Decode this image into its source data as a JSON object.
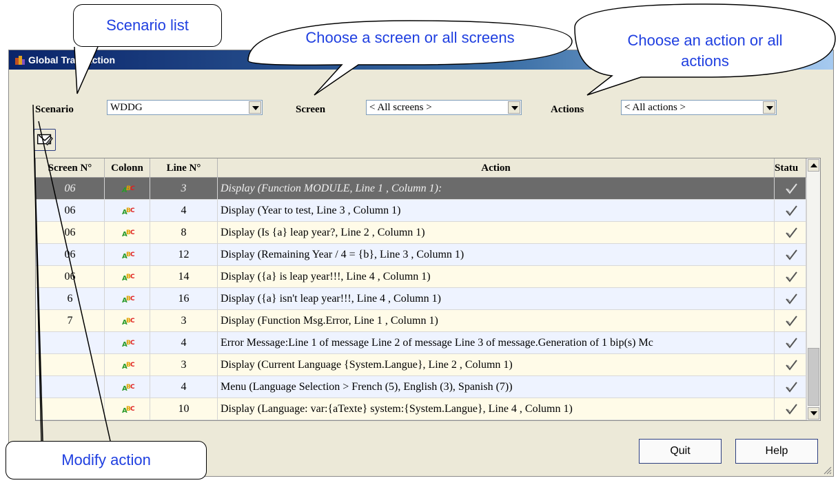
{
  "window": {
    "title": "Global Transaction"
  },
  "filters": {
    "scenario_label": "Scenario",
    "scenario_value": "WDDG",
    "screen_label": "Screen",
    "screen_value": "< All screens >",
    "actions_label": "Actions",
    "actions_value": "< All actions >"
  },
  "grid": {
    "columns": [
      "Screen N°",
      "Colonn",
      "Line N°",
      "Action",
      "Statu"
    ],
    "rows": [
      {
        "screen": "06",
        "line": "3",
        "action": "Display (Function MODULE, Line 1 , Column 1):"
      },
      {
        "screen": "06",
        "line": "4",
        "action": "Display (Year to test, Line 3 , Column 1)"
      },
      {
        "screen": "06",
        "line": "8",
        "action": "Display (Is {a} leap year?, Line 2 , Column 1)"
      },
      {
        "screen": "06",
        "line": "12",
        "action": "Display (Remaining Year / 4 = {b}, Line 3 , Column 1)"
      },
      {
        "screen": "06",
        "line": "14",
        "action": "Display ({a} is leap year!!!, Line 4 , Column 1)"
      },
      {
        "screen": "6",
        "line": "16",
        "action": "Display ({a} isn't leap year!!!, Line 4 , Column 1)"
      },
      {
        "screen": "7",
        "line": "3",
        "action": "Display (Function Msg.Error, Line 1 , Column 1)"
      },
      {
        "screen": "",
        "line": "4",
        "action": "Error Message:Line 1 of message Line 2 of message Line 3 of message.Generation of 1 bip(s) Mc"
      },
      {
        "screen": "",
        "line": "3",
        "action": "Display (Current Language {System.Langue}, Line 2 , Column 1)"
      },
      {
        "screen": "",
        "line": "4",
        "action": "Menu (Language Selection > French (5), English (3), Spanish  (7))"
      },
      {
        "screen": "",
        "line": "10",
        "action": "Display (Language: var:{aTexte} system:{System.Langue}, Line 4 , Column 1)"
      }
    ]
  },
  "buttons": {
    "quit": "Quit",
    "help": "Help"
  },
  "callouts": {
    "scenario_list": "Scenario list",
    "choose_screen": "Choose a screen or all screens",
    "choose_action_1": "Choose an action or all",
    "choose_action_2": "actions",
    "modify_action": "Modify action"
  },
  "icons": {
    "title": "app-icon",
    "modify": "modify-action-icon",
    "column": "abc-color-icon",
    "status": "checkmark-icon"
  }
}
